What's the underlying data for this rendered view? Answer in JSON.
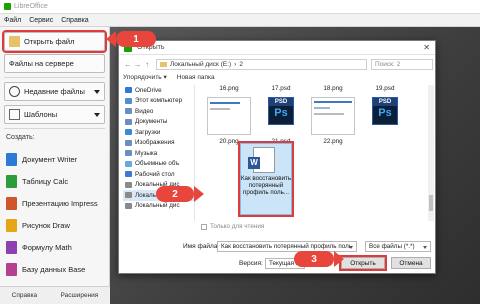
{
  "app": {
    "title": "LibreOffice",
    "menu": [
      "Файл",
      "Сервис",
      "Справка"
    ]
  },
  "sidebar": {
    "open_file": "Открыть файл",
    "remote_files": "Файлы на сервере",
    "recent_files": "Недавние файлы",
    "templates": "Шаблоны",
    "create_label": "Создать:",
    "create_items": [
      {
        "label": "Документ Writer",
        "color": "#2c7ad6"
      },
      {
        "label": "Таблицу Calc",
        "color": "#2e9b3c"
      },
      {
        "label": "Презентацию Impress",
        "color": "#d0542c"
      },
      {
        "label": "Рисунок Draw",
        "color": "#e6a515"
      },
      {
        "label": "Формулу Math",
        "color": "#8e3fb0"
      },
      {
        "label": "Базу данных Base",
        "color": "#b5408f"
      }
    ],
    "footer": {
      "help": "Справка",
      "extensions": "Расширения"
    }
  },
  "dialog": {
    "title": "Открыть",
    "path": [
      "Локальный диск (E:)",
      "2"
    ],
    "search_placeholder": "Поиск: 2",
    "toolbar": {
      "organize": "Упорядочить ▾",
      "new_folder": "Новая папка"
    },
    "nav": [
      {
        "label": "OneDrive",
        "color": "#2f78d6"
      },
      {
        "label": "Этот компьютер",
        "color": "#4f8fd1"
      },
      {
        "label": "Видео",
        "color": "#6a8ec0"
      },
      {
        "label": "Документы",
        "color": "#6a8ec0"
      },
      {
        "label": "Загрузки",
        "color": "#3b8ad8"
      },
      {
        "label": "Изображения",
        "color": "#6a8ec0"
      },
      {
        "label": "Музыка",
        "color": "#6a8ec0"
      },
      {
        "label": "Объемные объ",
        "color": "#6aa8dd"
      },
      {
        "label": "Рабочий стол",
        "color": "#3b7bd1"
      },
      {
        "label": "Локальный дис",
        "color": "#8a8a8a"
      },
      {
        "label": "Локальный дис",
        "color": "#8a8a8a",
        "selected": true
      },
      {
        "label": "Локальный дис",
        "color": "#8a8a8a"
      }
    ],
    "files": {
      "row1": [
        "16.png",
        "17.psd",
        "18.png",
        "19.psd"
      ],
      "row2": [
        "20.png",
        "21.psd",
        "22.png"
      ],
      "psd_label": "PSD",
      "psd_icon": "Ps",
      "selected_doc": "Как восстановить потерянный профиль поль..."
    },
    "readonly": "Только для чтения",
    "filename_label": "Имя файла:",
    "filename_value": "Как восстановить потерянный профиль поль",
    "filetype_value": "Все файлы (*.*)",
    "version_label": "Версия:",
    "version_value": "Текущая ве",
    "open_button": "Открыть",
    "cancel_button": "Отмена"
  },
  "callouts": [
    "1",
    "2",
    "3"
  ]
}
